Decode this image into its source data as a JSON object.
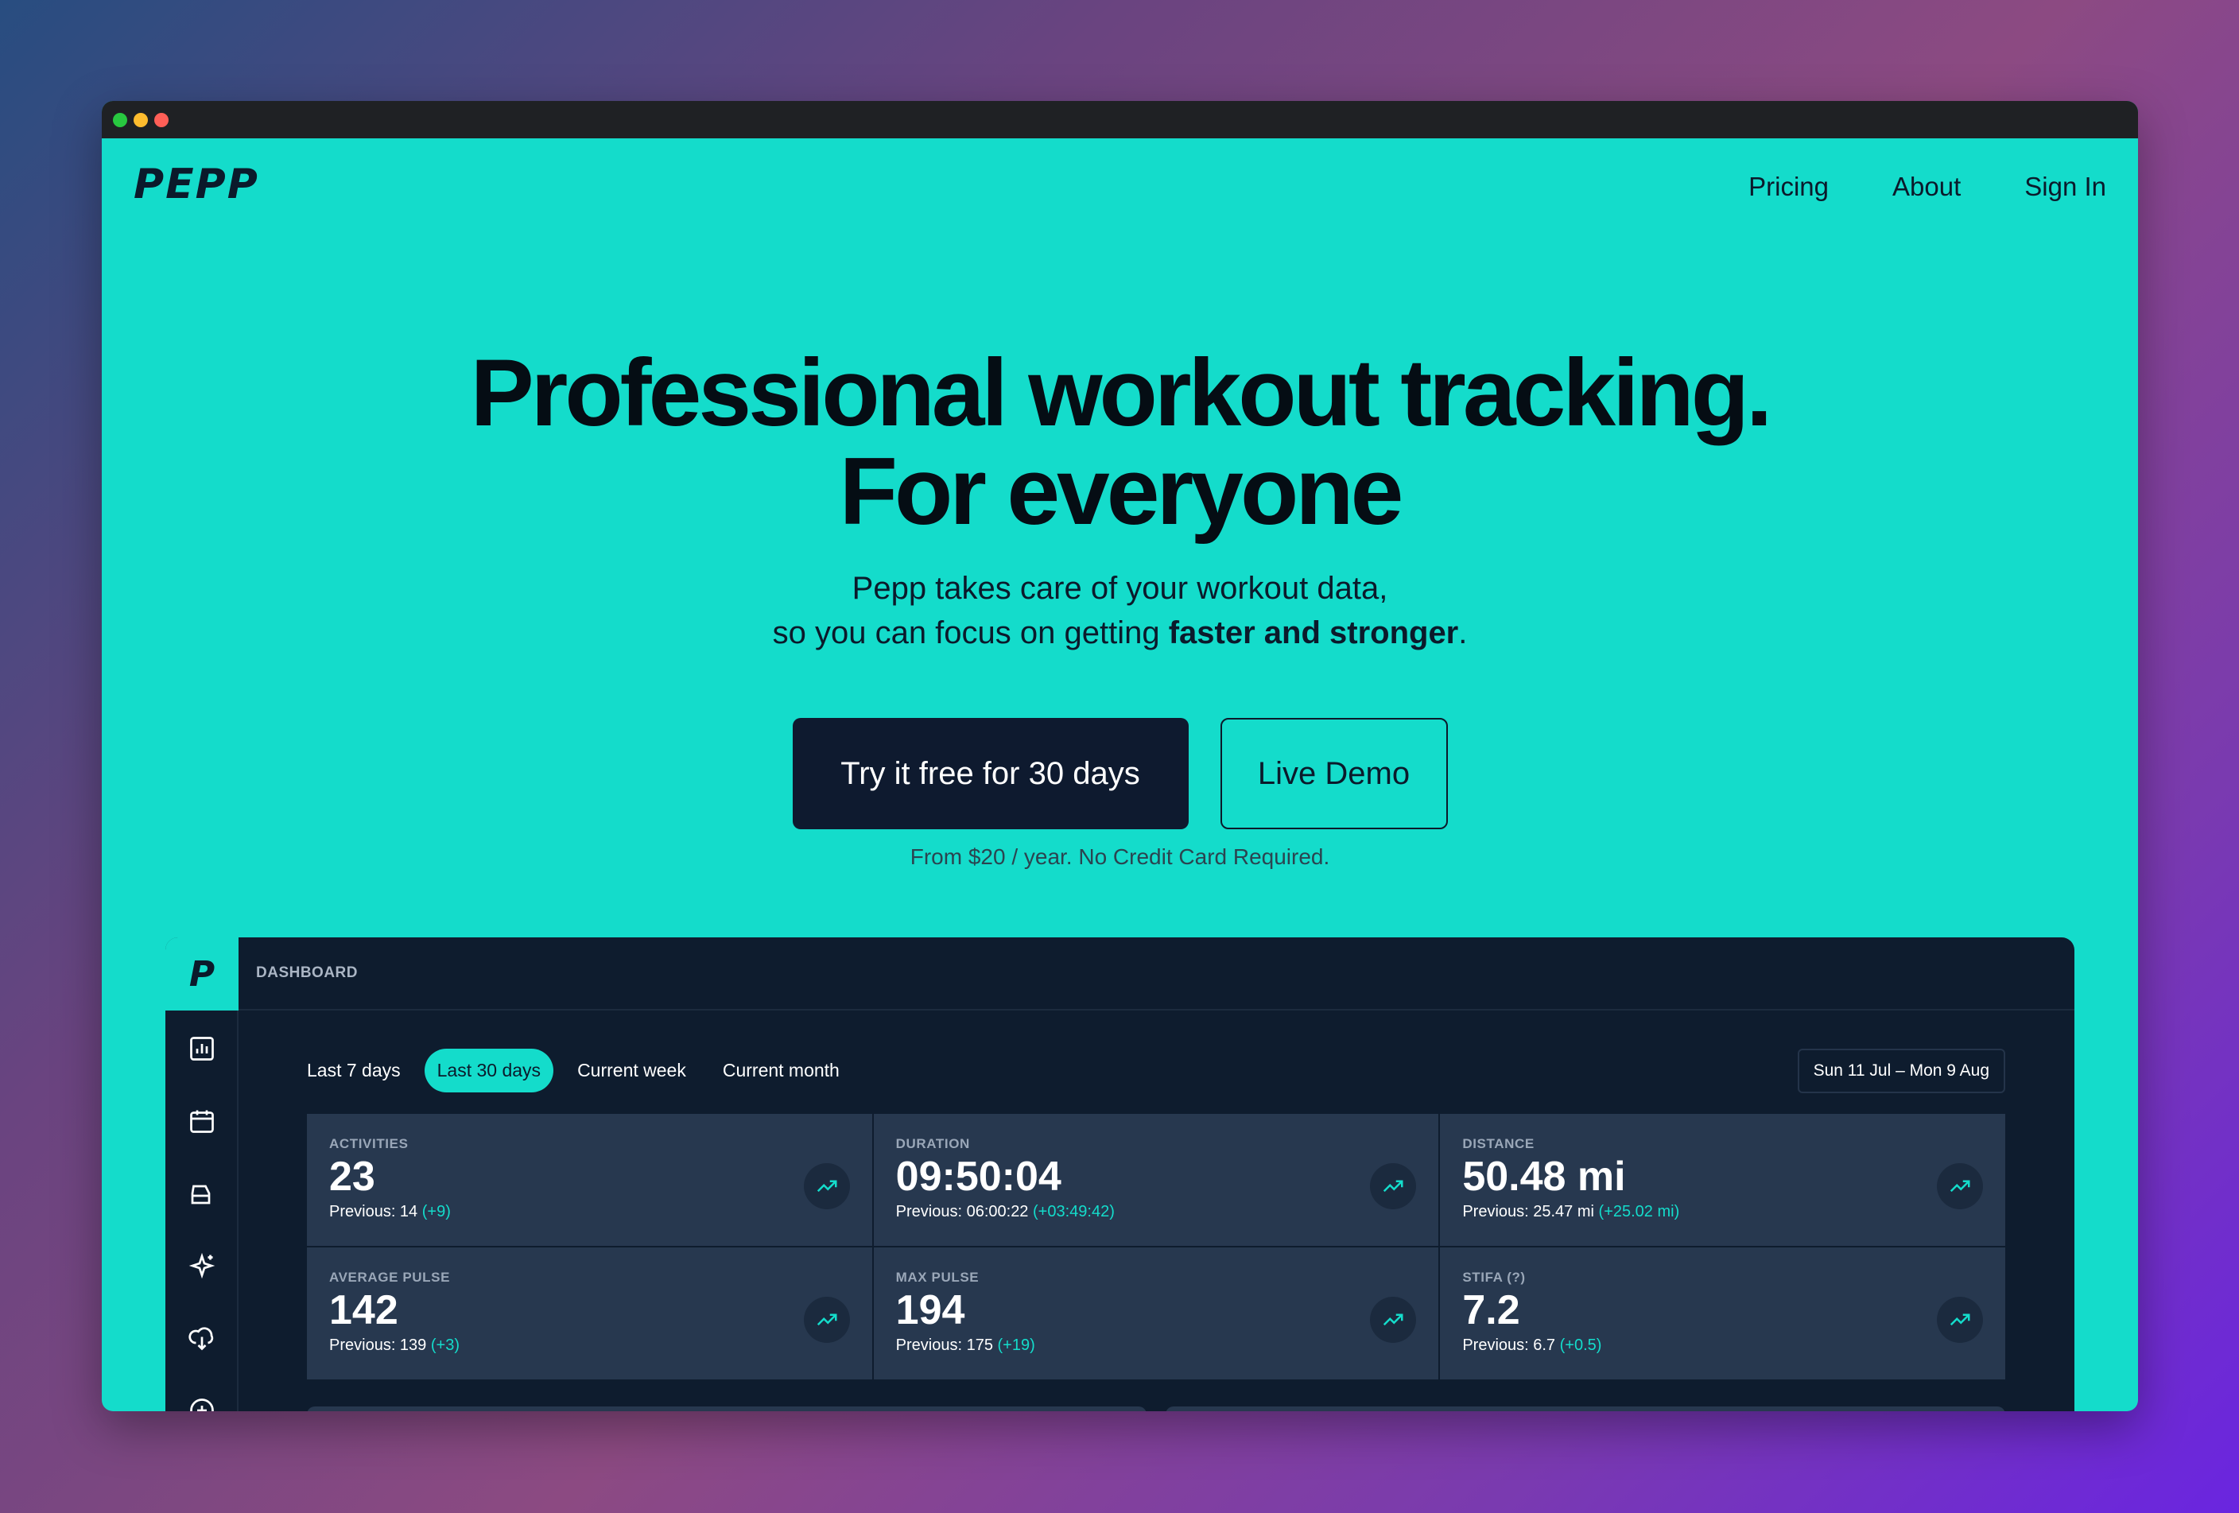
{
  "window": {
    "controls": [
      "close",
      "minimize",
      "maximize"
    ]
  },
  "nav": {
    "logo": "PEPP",
    "links": [
      "Pricing",
      "About",
      "Sign In"
    ]
  },
  "hero": {
    "title_line1": "Professional workout tracking.",
    "title_line2": "For everyone",
    "subtitle_line1": "Pepp takes care of your workout data,",
    "subtitle_line2_prefix": "so you can focus on getting ",
    "subtitle_line2_bold": "faster and stronger",
    "subtitle_line2_suffix": ".",
    "cta_primary": "Try it free for 30 days",
    "cta_secondary": "Live Demo",
    "cta_note": "From $20 / year. No Credit Card Required."
  },
  "dashboard": {
    "logo": "P",
    "title": "DASHBOARD",
    "sidebar_icons": [
      "bar-chart-icon",
      "calendar-icon",
      "shoe-icon",
      "sparkles-icon",
      "cloud-download-icon",
      "plus-circle-icon"
    ],
    "range_tabs": [
      "Last 7 days",
      "Last 30 days",
      "Current week",
      "Current month"
    ],
    "active_range": "Last 30 days",
    "date_range": "Sun 11 Jul – Mon 9 Aug",
    "stats": [
      {
        "label": "ACTIVITIES",
        "value": "23",
        "previous": "Previous: 14",
        "delta": "(+9)"
      },
      {
        "label": "DURATION",
        "value": "09:50:04",
        "previous": "Previous: 06:00:22",
        "delta": "(+03:49:42)"
      },
      {
        "label": "DISTANCE",
        "value": "50.48 mi",
        "previous": "Previous: 25.47 mi",
        "delta": "(+25.02 mi)"
      },
      {
        "label": "AVERAGE PULSE",
        "value": "142",
        "previous": "Previous: 139",
        "delta": "(+3)"
      },
      {
        "label": "MAX PULSE",
        "value": "194",
        "previous": "Previous: 175",
        "delta": "(+19)"
      },
      {
        "label": "STIFA (?)",
        "value": "7.2",
        "previous": "Previous: 6.7",
        "delta": "(+0.5)"
      }
    ],
    "colors": {
      "accent": "#14dccb",
      "panel": "#0e1c2e",
      "card": "#27384f"
    }
  }
}
